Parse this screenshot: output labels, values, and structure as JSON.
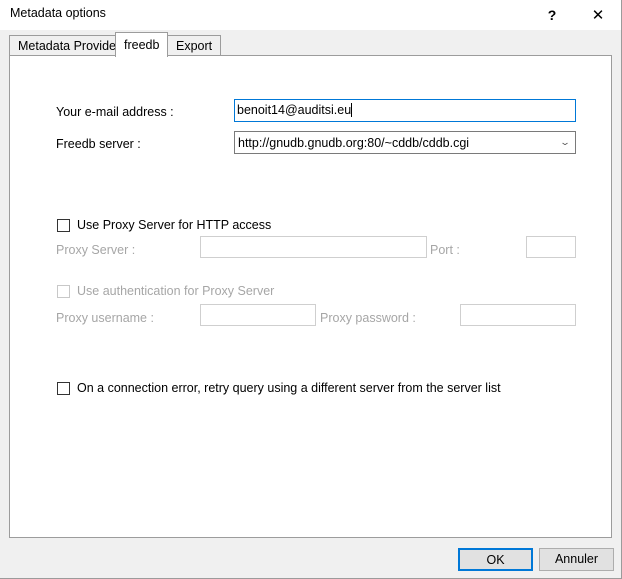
{
  "window": {
    "title": "Metadata options",
    "help_label": "?",
    "close_label": "✕"
  },
  "tabs": [
    {
      "label": "Metadata Provider",
      "active": false
    },
    {
      "label": "freedb",
      "active": true
    },
    {
      "label": "Export",
      "active": false
    }
  ],
  "form": {
    "email": {
      "label": "Your e-mail address :",
      "value": "benoit14@auditsi.eu",
      "placeholder": "",
      "focused": true
    },
    "server": {
      "label": "Freedb server :",
      "value": "http://gnudb.gnudb.org:80/~cddb/cddb.cgi",
      "arrow_icon": "⌄"
    },
    "use_proxy": {
      "label": "Use Proxy Server for HTTP access",
      "checked": false,
      "enabled": true
    },
    "proxy_server": {
      "label": "Proxy Server :",
      "value": "",
      "enabled": false
    },
    "port": {
      "label": "Port :",
      "value": "",
      "enabled": false
    },
    "use_auth": {
      "label": "Use authentication for Proxy Server",
      "checked": false,
      "enabled": false
    },
    "proxy_username": {
      "label": "Proxy username :",
      "value": "",
      "enabled": false
    },
    "proxy_password": {
      "label": "Proxy password :",
      "value": "",
      "enabled": false
    },
    "retry": {
      "label": "On a connection error, retry query using a different server from the server list",
      "checked": false,
      "enabled": true
    }
  },
  "footer": {
    "ok_label": "OK",
    "cancel_label": "Annuler"
  },
  "colors": {
    "accent": "#0078d7",
    "dialog_bg": "#f0f0f0",
    "panel_bg": "#ffffff",
    "disabled_text": "#a6a6a6"
  }
}
